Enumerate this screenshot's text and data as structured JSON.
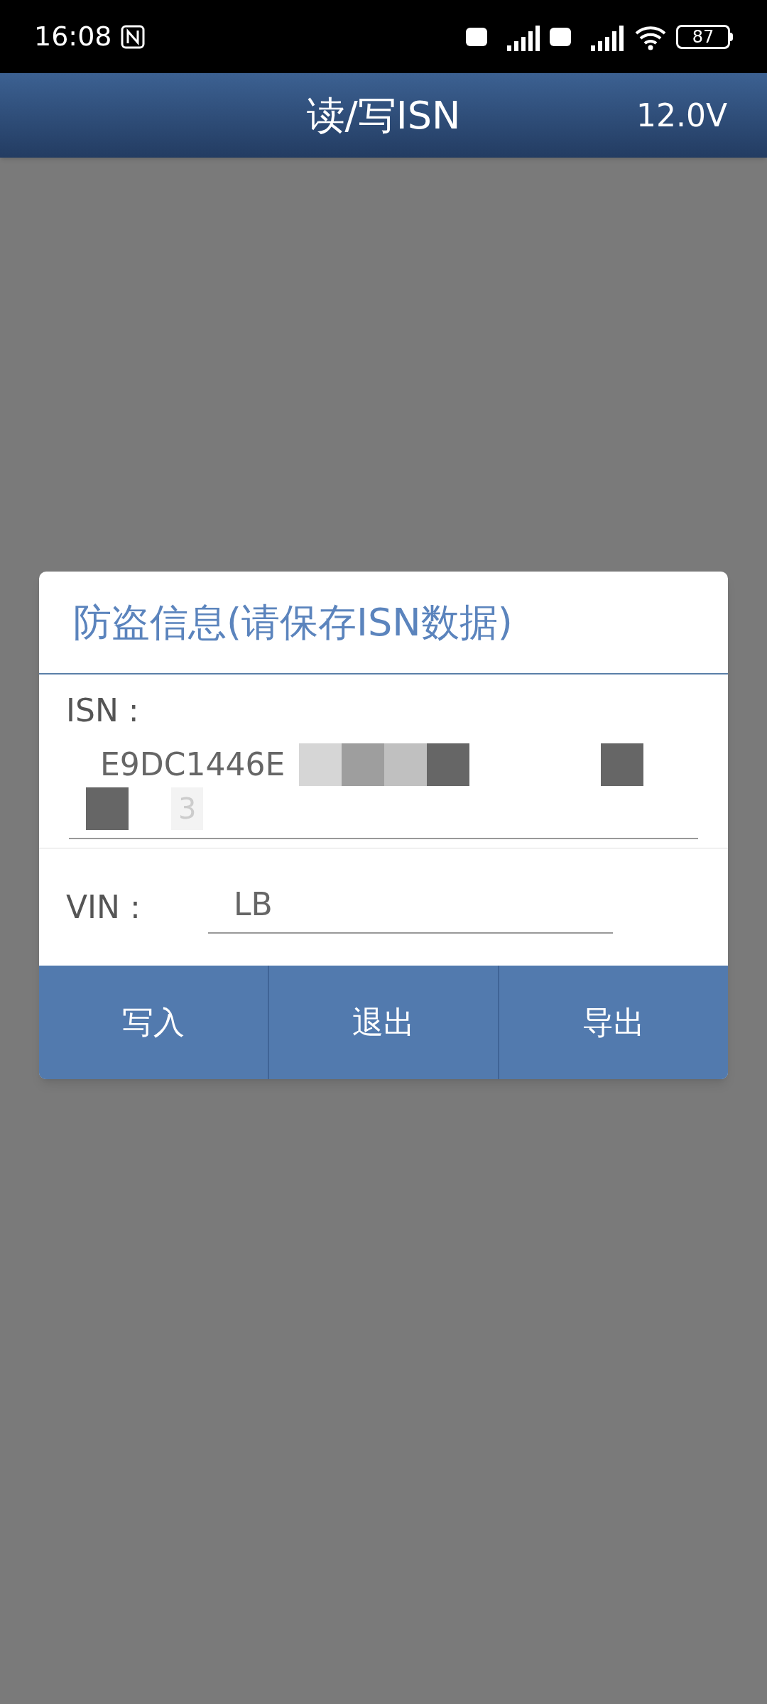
{
  "status_bar": {
    "time": "16:08",
    "battery": "87"
  },
  "header": {
    "title": "读/写ISN",
    "voltage": "12.0V"
  },
  "dialog": {
    "title": "防盗信息(请保存ISN数据)",
    "isn": {
      "label": "ISN :",
      "value_lines": [
        "E9DC1446E",
        "3"
      ]
    },
    "vin": {
      "label": "VIN :",
      "value": "LB"
    },
    "buttons": [
      "写入",
      "退出",
      "导出"
    ]
  }
}
